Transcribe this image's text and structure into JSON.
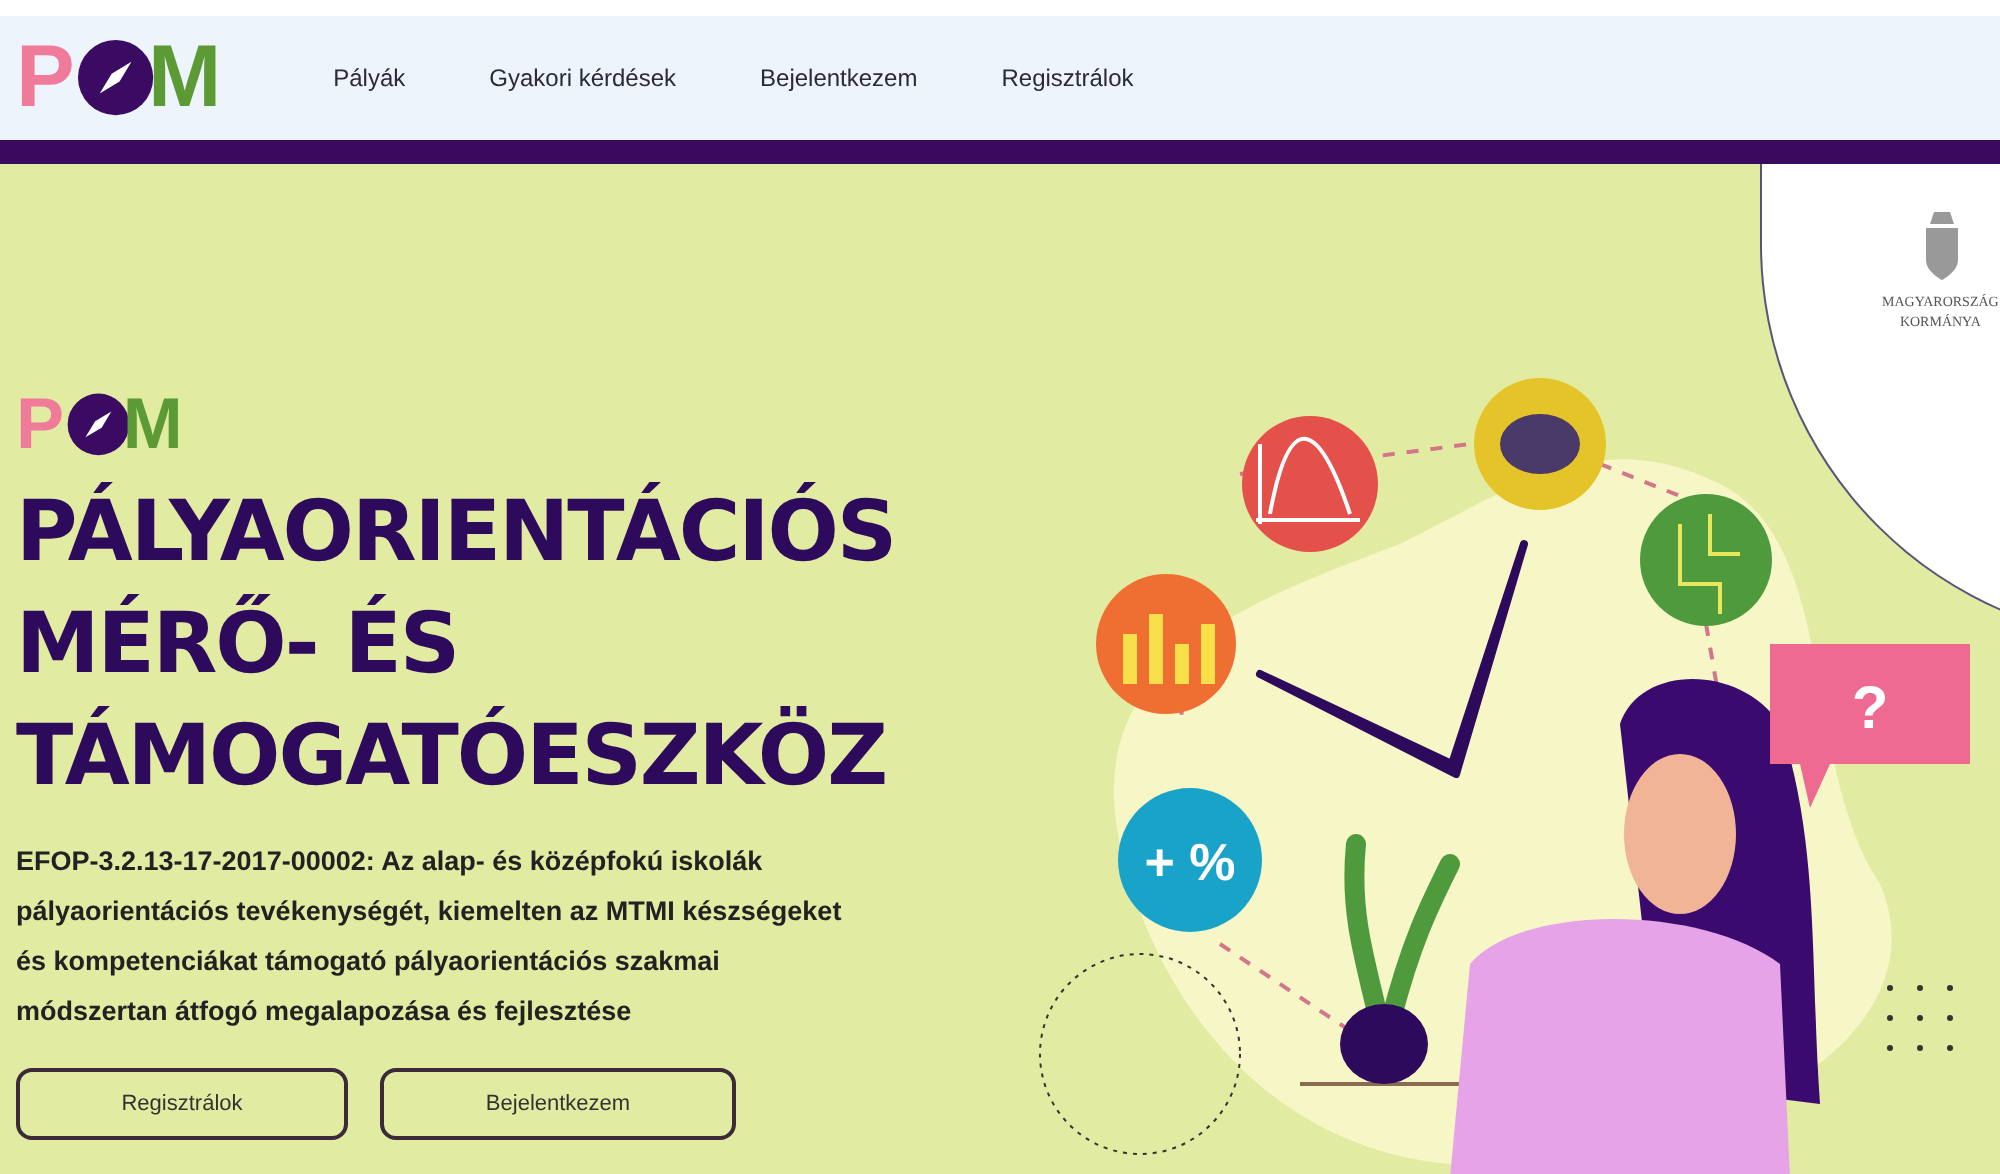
{
  "nav": {
    "logo": {
      "letters": [
        "P",
        "M"
      ]
    },
    "links": [
      "Pályák",
      "Gyakori kérdések",
      "Bejelentkezem",
      "Regisztrálok"
    ]
  },
  "government_logo": {
    "lines": [
      "MAGYARORSZÁG",
      "KORMÁNYA"
    ]
  },
  "hero": {
    "logo": {
      "letters": [
        "P",
        "M"
      ]
    },
    "title_lines": [
      "PÁLYAORIENTÁCIÓS",
      "MÉRŐ- ÉS",
      "TÁMOGATÓESZKÖZ"
    ],
    "description": "EFOP-3.2.13-17-2017-00002: Az alap- és középfokú iskolák pályaorientációs tevékenységét, kiemelten az MTMI készségeket és kompetenciákat támogató pályaorientációs szakmai módszertan átfogó megalapozása és fejlesztése",
    "buttons": [
      "Regisztrálok",
      "Bejelentkezem"
    ]
  },
  "illustration": {
    "math_symbols": "+ %",
    "speech_bubble": "?"
  }
}
